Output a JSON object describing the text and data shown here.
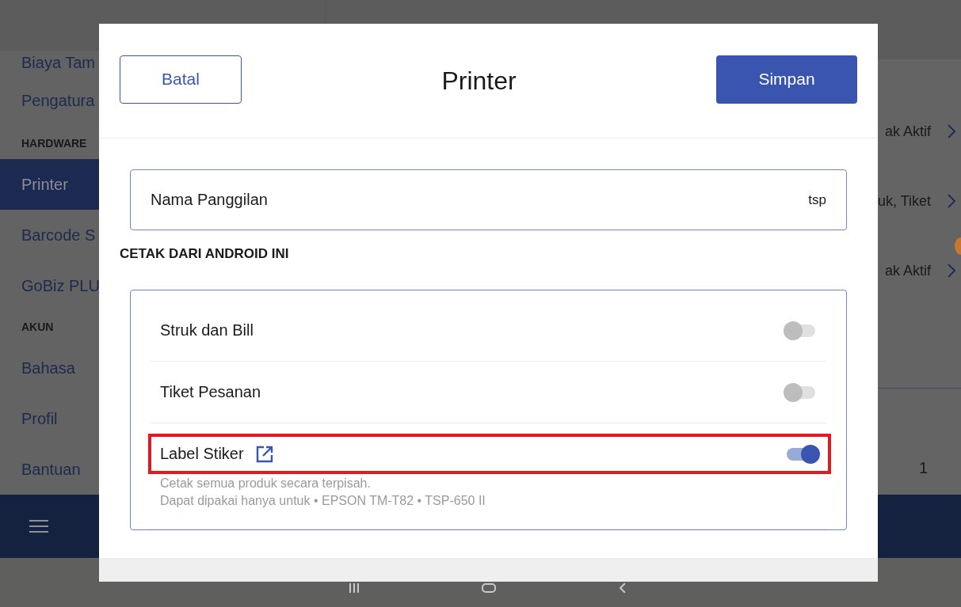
{
  "sidebar": {
    "items": [
      {
        "label": "Biaya Tam",
        "kind": "item",
        "selected": false
      },
      {
        "label": "Pengatura",
        "kind": "item",
        "selected": false
      },
      {
        "label": "HARDWARE",
        "kind": "header"
      },
      {
        "label": "Printer",
        "kind": "item",
        "selected": true
      },
      {
        "label": "Barcode S",
        "kind": "item",
        "selected": false
      },
      {
        "label": "GoBiz PLU",
        "kind": "item",
        "selected": false
      },
      {
        "label": "AKUN",
        "kind": "header"
      },
      {
        "label": "Bahasa",
        "kind": "item",
        "selected": false
      },
      {
        "label": "Profil",
        "kind": "item",
        "selected": false
      },
      {
        "label": "Bantuan",
        "kind": "item",
        "selected": false
      }
    ]
  },
  "detail": {
    "rows": [
      {
        "value": "ak Aktif"
      },
      {
        "value": "uk, Tiket"
      },
      {
        "value": "ak Aktif"
      }
    ],
    "count": "1"
  },
  "modal": {
    "cancel": "Batal",
    "title": "Printer",
    "save": "Simpan",
    "nickname": {
      "label": "Nama Panggilan",
      "value": "tsp"
    },
    "section": "CETAK DARI ANDROID INI",
    "options": [
      {
        "label": "Struk dan Bill",
        "on": false,
        "link": false,
        "highlighted": false
      },
      {
        "label": "Tiket Pesanan",
        "on": false,
        "link": false,
        "highlighted": false
      },
      {
        "label": "Label Stiker",
        "on": true,
        "link": true,
        "highlighted": true,
        "description": [
          "Cetak semua produk secara terpisah.",
          "Dapat dipakai hanya untuk • EPSON TM-T82 • TSP-650 II"
        ]
      }
    ]
  }
}
